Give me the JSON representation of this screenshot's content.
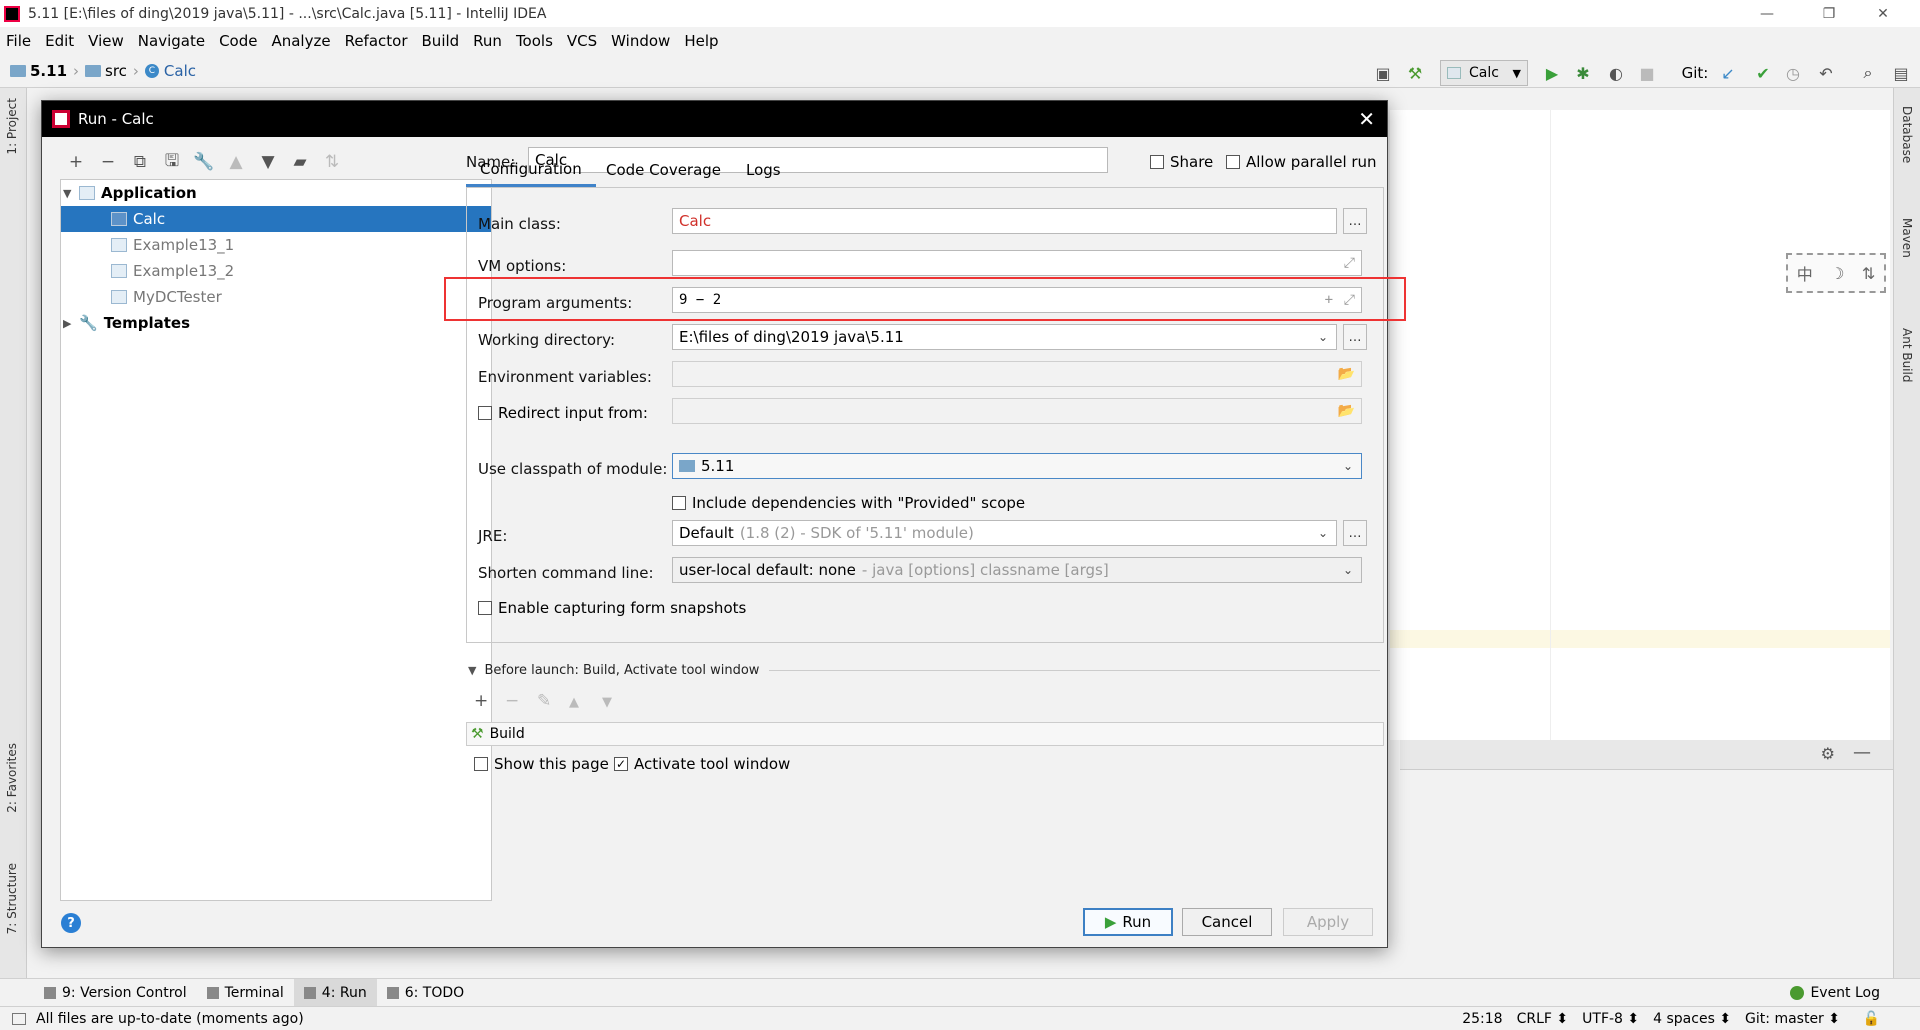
{
  "window": {
    "title": "5.11 [E:\\files of ding\\2019 java\\5.11] - ...\\src\\Calc.java [5.11] - IntelliJ IDEA",
    "controls": [
      "—",
      "❐",
      "✕"
    ]
  },
  "menu": [
    "File",
    "Edit",
    "View",
    "Navigate",
    "Code",
    "Analyze",
    "Refactor",
    "Build",
    "Run",
    "Tools",
    "VCS",
    "Window",
    "Help"
  ],
  "breadcrumb": {
    "project": "5.11",
    "src": "src",
    "file": "Calc"
  },
  "toolbar": {
    "run_config": "Calc",
    "git_label": "Git:"
  },
  "side_tools": {
    "left": [
      "1: Project",
      "2: Favorites",
      "7: Structure"
    ],
    "right": [
      "Database",
      "Maven",
      "Ant Build"
    ]
  },
  "ime": [
    "中",
    "☽",
    "⇅"
  ],
  "dialog": {
    "title": "Run - Calc",
    "tree": {
      "application": "Application",
      "items": [
        "Calc",
        "Example13_1",
        "Example13_2",
        "MyDCTester"
      ],
      "templates": "Templates"
    },
    "name_label": "Name:",
    "name_value": "Calc",
    "share_label": "Share",
    "parallel_label": "Allow parallel run",
    "tabs": [
      "Configuration",
      "Code Coverage",
      "Logs"
    ],
    "main_class_label": "Main class:",
    "main_class_value": "Calc",
    "vm_options_label": "VM options:",
    "vm_options_value": "",
    "program_args_label": "Program arguments:",
    "program_args_value": "9 − 2",
    "working_dir_label": "Working directory:",
    "working_dir_value": "E:\\files of ding\\2019 java\\5.11",
    "env_label": "Environment variables:",
    "redirect_label": "Redirect input from:",
    "classpath_label": "Use classpath of module:",
    "classpath_value": "5.11",
    "include_deps_label": "Include dependencies with \"Provided\" scope",
    "jre_label": "JRE:",
    "jre_value": "Default",
    "jre_hint": "(1.8 (2) - SDK of '5.11' module)",
    "shorten_label": "Shorten command line:",
    "shorten_value": "user-local default: none",
    "shorten_hint": "- java [options] classname [args]",
    "snapshots_label": "Enable capturing form snapshots",
    "before_launch_label": "Before launch: Build, Activate tool window",
    "build_item": "Build",
    "show_page_label": "Show this page",
    "activate_label": "Activate tool window",
    "run_button": "Run",
    "cancel_button": "Cancel",
    "apply_button": "Apply"
  },
  "bottom_tabs": [
    "9: Version Control",
    "Terminal",
    "4: Run",
    "6: TODO"
  ],
  "event_log": "Event Log",
  "status": {
    "message": "All files are up-to-date (moments ago)",
    "position": "25:18",
    "line_sep": "CRLF ⬍",
    "encoding": "UTF-8 ⬍",
    "indent": "4 spaces ⬍",
    "git": "Git: master ⬍"
  }
}
